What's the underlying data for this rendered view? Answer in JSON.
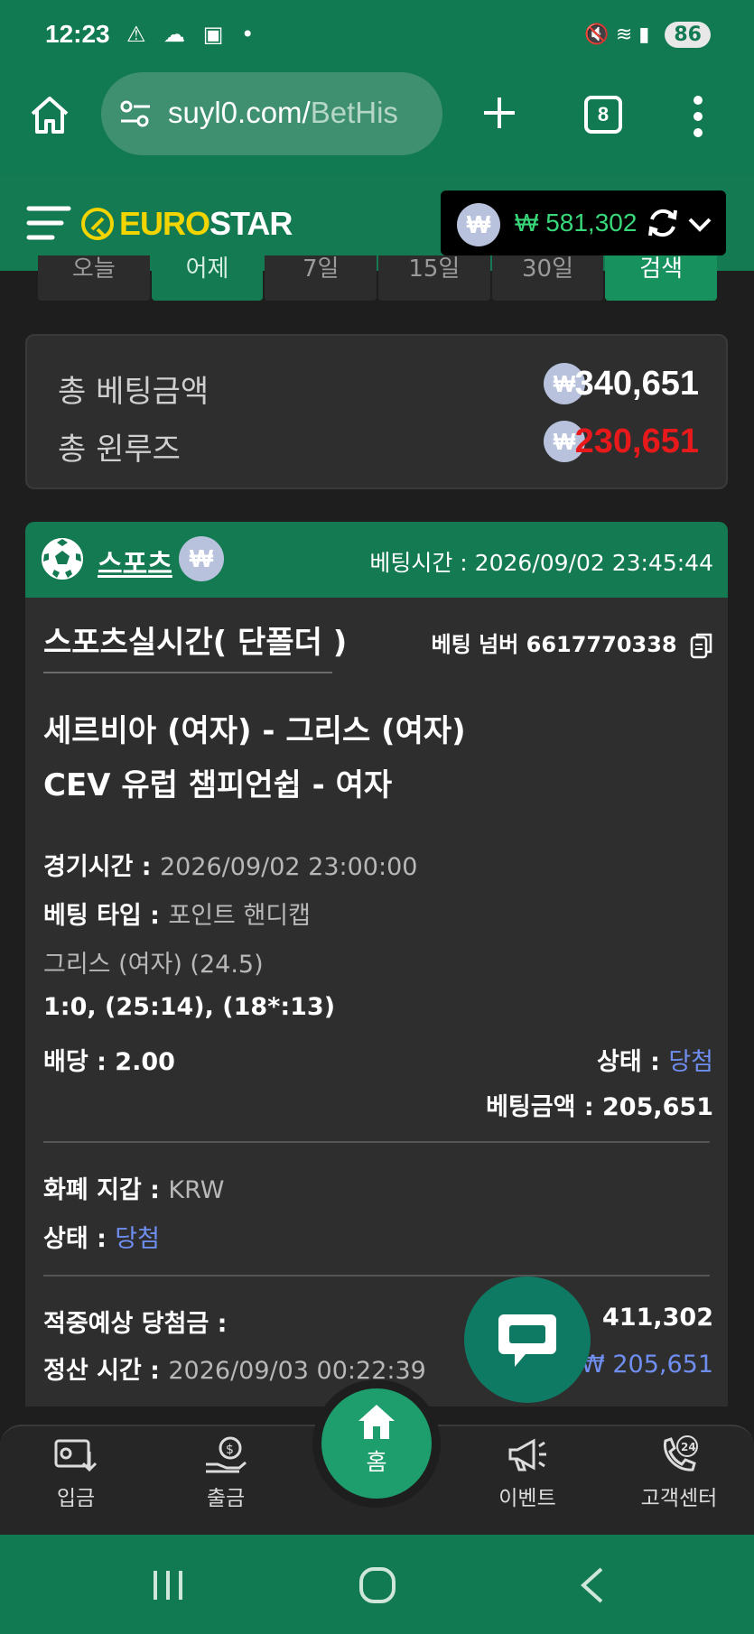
{
  "status_bar": {
    "time": "12:23",
    "battery": "86"
  },
  "browser": {
    "url_main": "suyl0.com/",
    "url_rest": "BetHis",
    "tab_count": "8"
  },
  "site": {
    "logo_part1": "EURO",
    "logo_part2": "STAR",
    "currency_symbol": "₩",
    "balance": "₩ 581,302"
  },
  "period_filter": [
    "오늘",
    "어제",
    "7일",
    "15일",
    "30일",
    "검색"
  ],
  "totals": {
    "bet_label": "총 베팅금액",
    "bet_value": "340,651",
    "winloss_label": "총 윈루즈",
    "winloss_value": "230,651"
  },
  "card": {
    "sport": "스포츠",
    "bet_time": "베팅시간 : 2026/09/02 23:45:44",
    "title": "스포츠실시간( 단폴더 )",
    "bet_number": "베팅 넘버 6617770338",
    "match_line1": "세르비아 (여자) - 그리스 (여자)",
    "match_line2": "CEV 유럽 챔피언쉽 - 여자",
    "game_time_label": "경기시간 : ",
    "game_time_value": "2026/09/02 23:00:00",
    "bet_type_label": "베팅 타입 : ",
    "bet_type_value": "포인트 핸디캡",
    "selection": "그리스 (여자) (24.5)",
    "score": "1:0, (25:14), (18*:13)",
    "odds": "배당 : 2.00",
    "status_label": "상태 : ",
    "status_value": "당첨",
    "bet_amount": "베팅금액 : 205,651",
    "currency_wallet_label": "화폐 지갑 : ",
    "currency_wallet_value": "KRW",
    "status2_label": "상태 : ",
    "status2_value": "당첨",
    "expected_win_label": "적중예상 당첨금 :",
    "expected_win_value": "411,302",
    "settle_time_label": "정산 시간 : ",
    "settle_time_value": "2026/09/03 00:22:39",
    "settle_amount": "₩ 205,651"
  },
  "bottom_nav": {
    "deposit": "입금",
    "withdraw": "출금",
    "home": "홈",
    "event": "이벤트",
    "support": "고객센터",
    "support_badge": "24"
  },
  "colors": {
    "brand_green": "#137a52",
    "win_red": "#e8191a",
    "link_blue": "#6f8ef0",
    "logo_yellow": "#f2d400"
  }
}
